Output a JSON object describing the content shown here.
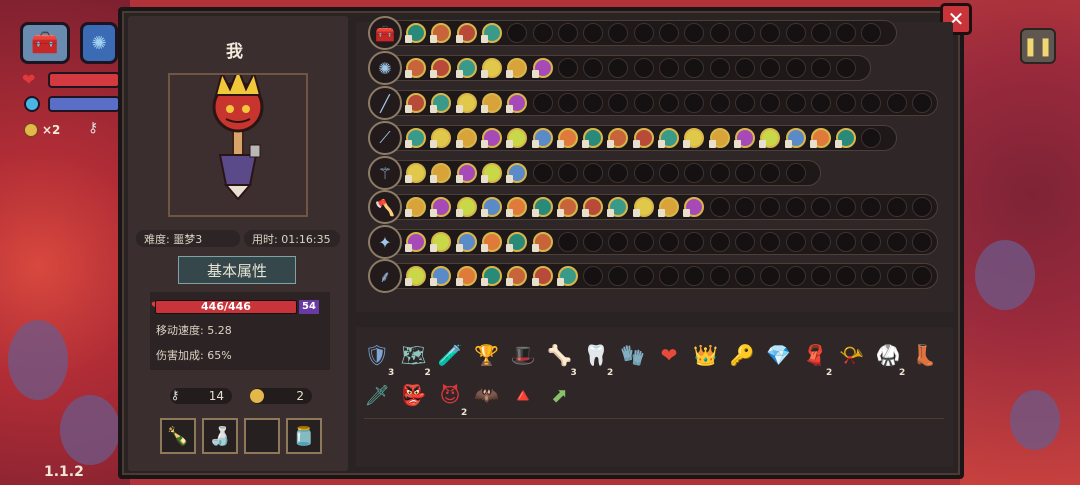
{
  "hud": {
    "coins": "×2",
    "version": "1.1.2"
  },
  "character": {
    "tag": "我",
    "difficulty": "难度: 噩梦3",
    "time": "用时: 01:16:35",
    "attr_title": "基本属性",
    "hp": "446/446",
    "armor": "54",
    "move_speed": "移动速度: 5.28",
    "damage_bonus": "伤害加成: 65%",
    "keys_count": "14",
    "coins_count": "2"
  },
  "weapon_rows": [
    {
      "weapon": "treasure-chest-icon",
      "chip_count": 4,
      "slot_total": 19
    },
    {
      "weapon": "blue-orb-icon",
      "chip_count": 6,
      "slot_total": 18
    },
    {
      "weapon": "staff-icon",
      "chip_count": 5,
      "slot_total": 22
    },
    {
      "weapon": "wand-icon",
      "chip_count": 18,
      "slot_total": 19
    },
    {
      "weapon": "scepter-icon",
      "chip_count": 5,
      "slot_total": 16
    },
    {
      "weapon": "axe-icon",
      "chip_count": 12,
      "slot_total": 22
    },
    {
      "weapon": "mace-icon",
      "chip_count": 6,
      "slot_total": 22
    },
    {
      "weapon": "rod-icon",
      "chip_count": 7,
      "slot_total": 22
    }
  ],
  "items": [
    {
      "icon": "blue-shield-icon",
      "glyph": "🛡",
      "count": "3",
      "color": "#7ea7d6"
    },
    {
      "icon": "map-icon",
      "glyph": "🗺",
      "count": "2",
      "color": "#8fc6c0"
    },
    {
      "icon": "potion-icon",
      "glyph": "🧪",
      "count": "",
      "color": "#5f7ed8"
    },
    {
      "icon": "trophy-icon",
      "glyph": "🏆",
      "count": "",
      "color": "#e3b84a"
    },
    {
      "icon": "witch-hat-icon",
      "glyph": "🎩",
      "count": "",
      "color": "#5aa36a"
    },
    {
      "icon": "bone-fish-icon",
      "glyph": "🦴",
      "count": "3",
      "color": "#e8d9b4"
    },
    {
      "icon": "teeth-icon",
      "glyph": "🦷",
      "count": "2",
      "color": "#e6e6e6"
    },
    {
      "icon": "gauntlet-icon",
      "glyph": "🧤",
      "count": "",
      "color": "#e0a54a"
    },
    {
      "icon": "heart-icon",
      "glyph": "❤",
      "count": "",
      "color": "#e64a3a"
    },
    {
      "icon": "crown-icon",
      "glyph": "👑",
      "count": "",
      "color": "#e4b43a"
    },
    {
      "icon": "key-icon",
      "glyph": "🔑",
      "count": "",
      "color": "#9fc6e6"
    },
    {
      "icon": "crystal-icon",
      "glyph": "💎",
      "count": "",
      "color": "#4a9ee0"
    },
    {
      "icon": "cloak-icon",
      "glyph": "🧣",
      "count": "2",
      "color": "#7a8aa8"
    },
    {
      "icon": "horn-icon",
      "glyph": "📯",
      "count": "",
      "color": "#e8dcc4"
    },
    {
      "icon": "belt-icon",
      "glyph": "🥋",
      "count": "2",
      "color": "#5a8a52"
    },
    {
      "icon": "boot-icon",
      "glyph": "👢",
      "count": "",
      "color": "#8e5ac6"
    },
    {
      "icon": "dagger-icon",
      "glyph": "🗡",
      "count": "",
      "color": "#5ab8a8"
    },
    {
      "icon": "goblin-icon",
      "glyph": "👺",
      "count": "",
      "color": "#6aa84a"
    },
    {
      "icon": "demon-mask-icon",
      "glyph": "😈",
      "count": "2",
      "color": "#d8363a"
    },
    {
      "icon": "dark-cape-icon",
      "glyph": "🦇",
      "count": "",
      "color": "#6a4a8a"
    },
    {
      "icon": "pyramid-icon",
      "glyph": "🔺",
      "count": "",
      "color": "#9a6ac6"
    },
    {
      "icon": "green-arrow-icon",
      "glyph": "⬈",
      "count": "",
      "color": "#8ac06a"
    }
  ],
  "potions": [
    {
      "icon": "pink-potion-icon",
      "glyph": "🍾"
    },
    {
      "icon": "yellow-potion-icon",
      "glyph": "🍶"
    },
    {
      "icon": "empty-slot-icon",
      "glyph": ""
    },
    {
      "icon": "grey-jar-icon",
      "glyph": "🫙"
    }
  ],
  "colors": {
    "panel_bg": "#2a2324",
    "chip_gold": "#d8b64a",
    "hp_red": "#c9343a",
    "armor_purple": "#6a3aa4"
  }
}
